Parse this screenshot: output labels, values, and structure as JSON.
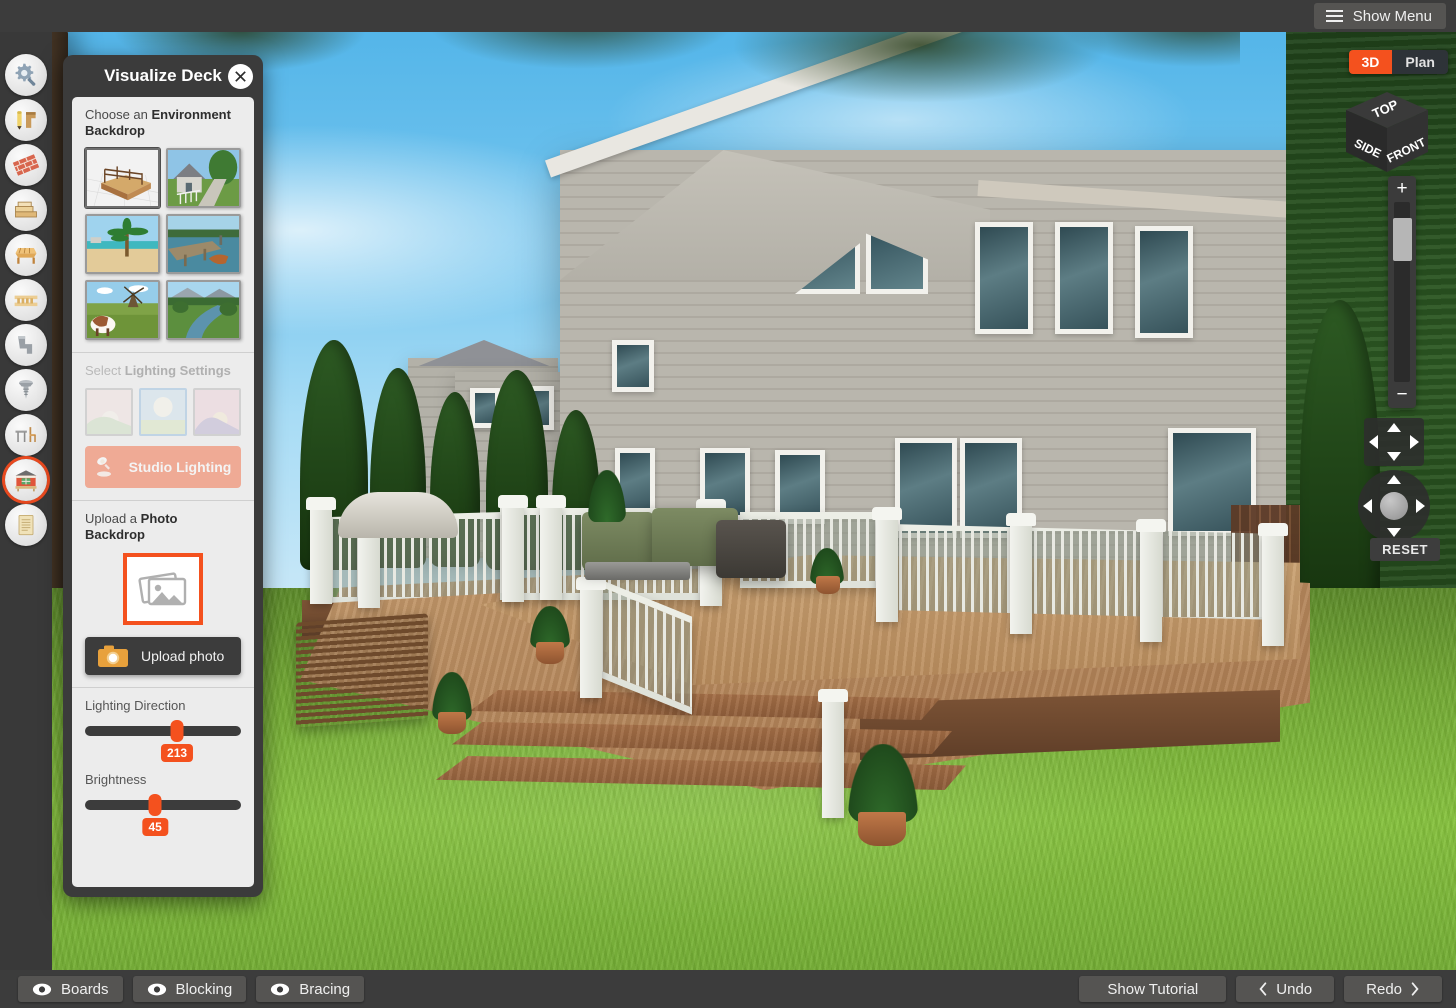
{
  "app": {
    "accent_color": "#f4511e",
    "panel_bg": "#3b3b3b",
    "bar_bg": "#3c3c3c"
  },
  "topbar": {
    "menu_label": "Show Menu",
    "menu_icon": "hamburger-icon"
  },
  "toolbar": {
    "items": [
      {
        "name": "settings-tool",
        "icon": "gear-wrench-icon",
        "active": false
      },
      {
        "name": "draw-deck-tool",
        "icon": "pencil-shape-icon",
        "active": false
      },
      {
        "name": "foundation-tool",
        "icon": "brick-wall-icon",
        "active": false
      },
      {
        "name": "decking-tool",
        "icon": "lumber-boards-icon",
        "active": false
      },
      {
        "name": "framing-tool",
        "icon": "frame-table-icon",
        "active": false
      },
      {
        "name": "joists-tool",
        "icon": "joist-rail-icon",
        "active": false
      },
      {
        "name": "hardware-tool",
        "icon": "bracket-icon",
        "active": false
      },
      {
        "name": "fasteners-tool",
        "icon": "screw-icon",
        "active": false
      },
      {
        "name": "furniture-tool",
        "icon": "table-chair-icon",
        "active": false
      },
      {
        "name": "visualize-tool",
        "icon": "house-deck-icon",
        "active": true
      },
      {
        "name": "materials-list-tool",
        "icon": "document-list-icon",
        "active": false
      }
    ]
  },
  "viewcontrols": {
    "view_3d_label": "3D",
    "view_plan_label": "Plan",
    "active_view": "3D",
    "cube_faces": {
      "top": "TOP",
      "side": "SIDE",
      "front": "FRONT"
    },
    "zoom_in_label": "+",
    "zoom_out_label": "−",
    "reset_label": "RESET"
  },
  "panel": {
    "title": "Visualize Deck",
    "close_icon": "close-icon",
    "environment": {
      "label_prefix": "Choose an ",
      "label_strong": "Environment",
      "label_suffix": "Backdrop",
      "thumbnails": [
        {
          "name": "backdrop-studio-deck",
          "caption": "studio-deck",
          "selected": true
        },
        {
          "name": "backdrop-suburban-home",
          "caption": "suburban-home",
          "selected": false
        },
        {
          "name": "backdrop-beach-palm",
          "caption": "beach-palm",
          "selected": false
        },
        {
          "name": "backdrop-lake-dock",
          "caption": "lake-dock",
          "selected": false
        },
        {
          "name": "backdrop-farm-windmill",
          "caption": "farm-windmill",
          "selected": false
        },
        {
          "name": "backdrop-river-valley",
          "caption": "river-valley",
          "selected": false
        }
      ]
    },
    "lighting": {
      "label_prefix": "Select ",
      "label_strong": "Lighting Settings",
      "disabled": true,
      "presets": [
        {
          "name": "lighting-dawn",
          "caption": "dawn",
          "selected": false
        },
        {
          "name": "lighting-midday",
          "caption": "midday",
          "selected": true
        },
        {
          "name": "lighting-sunset",
          "caption": "sunset",
          "selected": false
        }
      ],
      "studio_button_label": "Studio Lighting",
      "studio_button_icon": "studio-lamp-icon"
    },
    "photo": {
      "label_prefix": "Upload a ",
      "label_strong": "Photo",
      "label_suffix": "Backdrop",
      "dropzone_icon": "photos-stack-icon",
      "upload_button_label": "Upload photo",
      "upload_button_icon": "camera-icon"
    },
    "sliders": [
      {
        "name": "lighting-direction-slider",
        "label": "Lighting Direction",
        "value": 213,
        "min": 0,
        "max": 360
      },
      {
        "name": "brightness-slider",
        "label": "Brightness",
        "value": 45,
        "min": 0,
        "max": 100
      }
    ]
  },
  "bottombar": {
    "layers": [
      {
        "name": "toggle-boards",
        "label": "Boards",
        "icon": "eye-icon",
        "visible": true
      },
      {
        "name": "toggle-blocking",
        "label": "Blocking",
        "icon": "eye-icon",
        "visible": true
      },
      {
        "name": "toggle-bracing",
        "label": "Bracing",
        "icon": "eye-icon",
        "visible": true
      }
    ],
    "tutorial_label": "Show Tutorial",
    "undo_label": "Undo",
    "undo_icon": "chevron-left-icon",
    "redo_label": "Redo",
    "redo_icon": "chevron-right-icon"
  }
}
